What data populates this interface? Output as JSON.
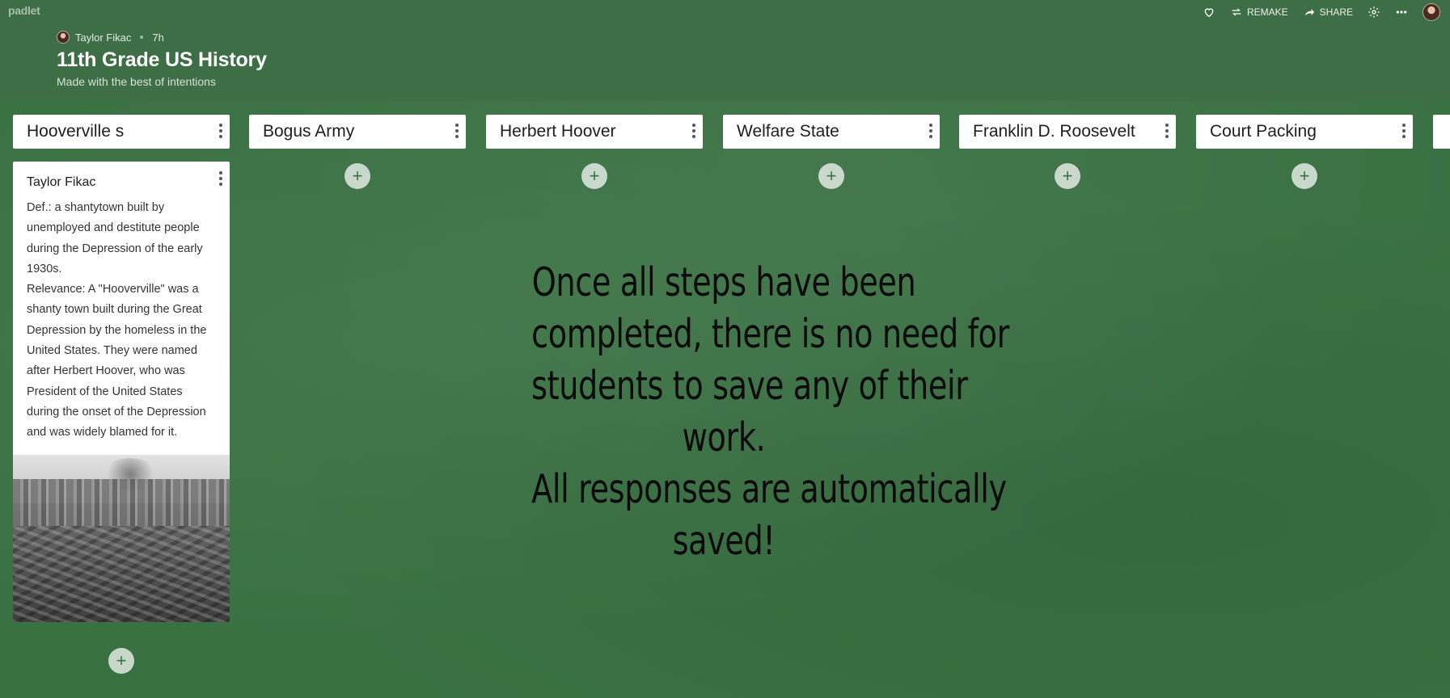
{
  "app": {
    "logo": "padlet"
  },
  "toolbar": {
    "remake_label": "REMAKE",
    "share_label": "SHARE"
  },
  "header": {
    "author": "Taylor Fikac",
    "time_ago": "7h",
    "title": "11th Grade US History",
    "subtitle": "Made with the best of intentions"
  },
  "columns": [
    {
      "title": "Hooverville s"
    },
    {
      "title": "Bogus Army"
    },
    {
      "title": "Herbert Hoover"
    },
    {
      "title": "Welfare State"
    },
    {
      "title": "Franklin D. Roosevelt"
    },
    {
      "title": "Court Packing"
    }
  ],
  "post": {
    "author": "Taylor Fikac",
    "lines": [
      "Def.: a shantytown built by",
      "unemployed and destitute people",
      "during the Depression of the early",
      "1930s.",
      "Relevance: A \"Hooverville\" was a",
      "shanty town built during the Great",
      "Depression by the homeless in the",
      "United States. They were named",
      "after Herbert Hoover, who was",
      "President of the United States",
      "during the onset of the Depression",
      "and was widely blamed for it."
    ]
  },
  "notice": {
    "lines": [
      "Once all steps have been",
      "completed, there is no need for",
      "students to save any of their",
      "work.",
      "All responses are automatically",
      "saved!"
    ]
  },
  "add_symbol": "+"
}
